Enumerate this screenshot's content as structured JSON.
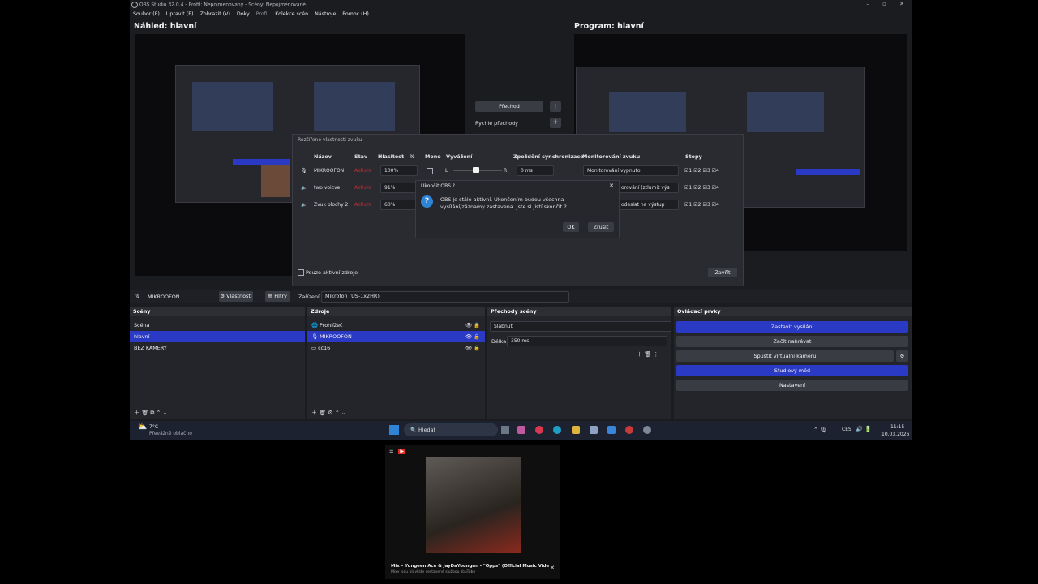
{
  "window": {
    "title": "OBS Studio 32.0.4 - Profil: Nepojmenovaný - Scény: Nepojmenované"
  },
  "menu": [
    "Soubor (F)",
    "Upravit (E)",
    "Zobrazit (V)",
    "Doky",
    "Profil",
    "Kolekce scén",
    "Nástroje",
    "Pomoc (H)"
  ],
  "preview_title": "Náhled: hlavní",
  "program_title": "Program: hlavní",
  "transition": {
    "button": "Přechod",
    "quick": "Rychlé přechody"
  },
  "mixer": {
    "title": "Rozšířené vlastnosti zvuku",
    "headers": {
      "name": "Název",
      "state": "Stav",
      "volume": "Hlasitost",
      "percent": "%",
      "mono": "Mono",
      "balance": "Vyvážení",
      "sync": "Zpoždění synchronizace",
      "monitor": "Monitorování zvuku",
      "tracks": "Stopy"
    },
    "rows": [
      {
        "name": "MIKROOFON",
        "state": "Aktivní",
        "volume": "100%",
        "sync": "0 ms",
        "monitor": "Monitorování vypnuto"
      },
      {
        "name": "two voicve",
        "state": "Aktivní",
        "volume": "91%",
        "monitor": "orování (ztlumit výs"
      },
      {
        "name": "Zvuk plochy 2",
        "state": "Aktivní",
        "volume": "60%",
        "monitor": "odeslat na výstup"
      }
    ],
    "balance_left": "L",
    "balance_right": "R",
    "tracks": [
      "1",
      "2",
      "3",
      "4"
    ],
    "only_active": "Pouze aktivní zdroje",
    "close": "Zavřít"
  },
  "confirm": {
    "title": "Ukončit OBS ?",
    "message": "OBS je stále aktivní. Ukončením budou všechna vysílání/záznamy zastavena. Jste si jistí skončit ?",
    "ok": "OK",
    "cancel": "Zrušit"
  },
  "source_toolbar": {
    "source": "MIKROOFON",
    "properties": "Vlastnosti",
    "filters": "Filtry",
    "device_label": "Zařízení",
    "device": "Mikrofon (US-1x2HR)"
  },
  "docks": {
    "scenes": {
      "title": "Scény",
      "items": [
        "Scéna",
        "hlavní",
        "BEZ KAMERY"
      ]
    },
    "sources": {
      "title": "Zdroje",
      "items": [
        "Prohlížeč",
        "MIKROOFON",
        "cc16"
      ]
    },
    "transitions": {
      "title": "Přechody scény",
      "type": "Slábnutí",
      "duration_label": "Délka",
      "duration": "350 ms"
    },
    "controls": {
      "title": "Ovládací prvky",
      "buttons": [
        "Zastavit vysílání",
        "Začít nahrávat",
        "Spustit virtuální kameru",
        "Studiový mód",
        "Nastavení"
      ]
    }
  },
  "taskbar": {
    "weather_temp": "7°C",
    "weather_text": "Převážně oblačno",
    "search": "Hledat",
    "lang": "CES",
    "time": "11:15",
    "date": "10.03.2026"
  },
  "player": {
    "title": "Mix – Yungeen Ace & JayDaYoungan - \"Opps\" (Official Music Video)",
    "subtitle": "Mixy jsou playlisty sestavené službou YouTube"
  },
  "colors": {
    "accent": "#2a3ac4",
    "status_active": "#c0303a"
  }
}
